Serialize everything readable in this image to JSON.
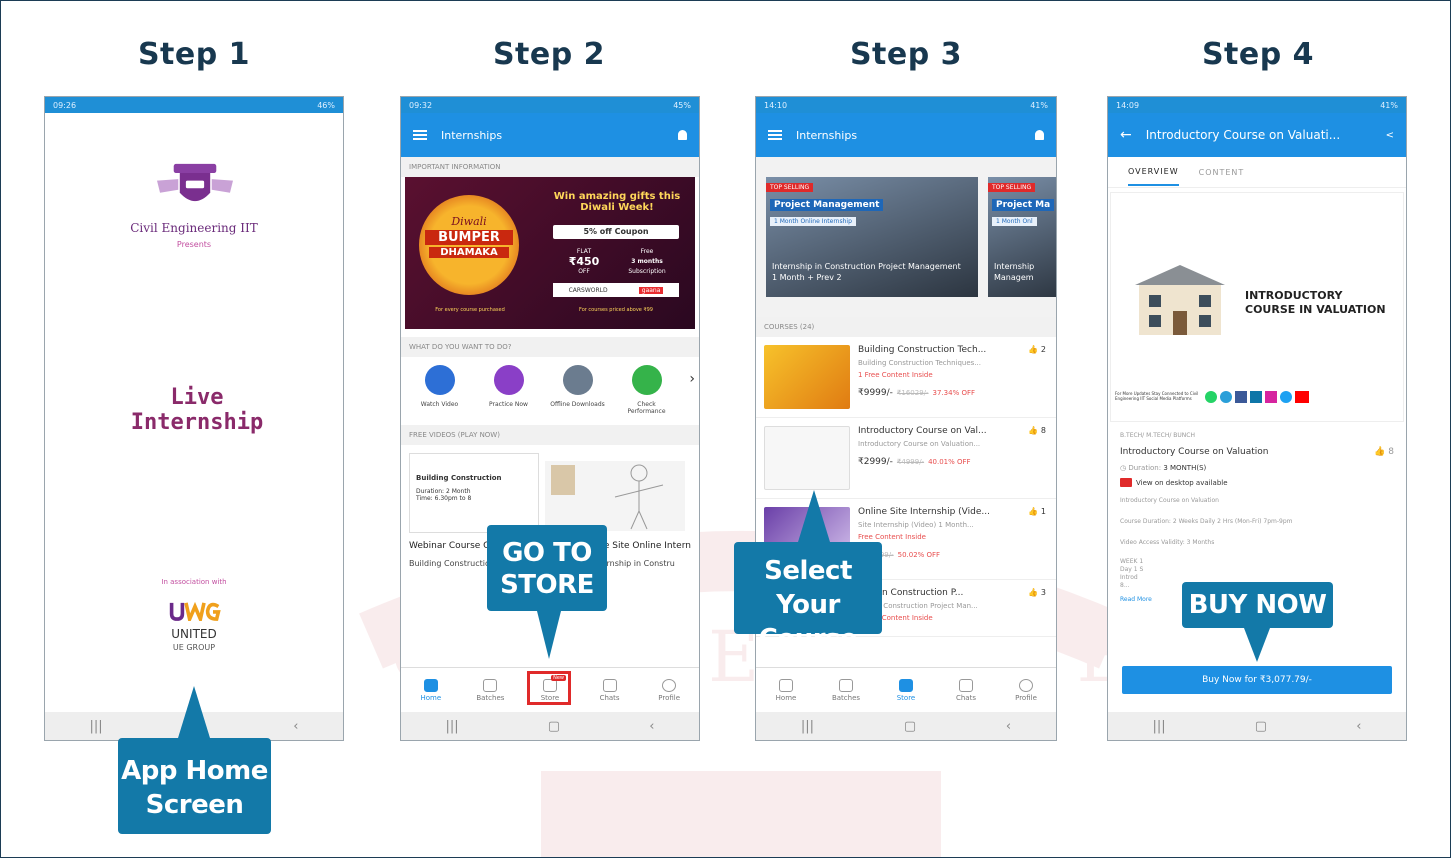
{
  "steps": [
    {
      "title": "Step 1"
    },
    {
      "title": "Step 2"
    },
    {
      "title": "Step 3"
    },
    {
      "title": "Step 4"
    }
  ],
  "callouts": {
    "home": "App Home Screen",
    "store": "GO TO STORE",
    "course": "Select Your Course",
    "buy": "BUY NOW"
  },
  "colors": {
    "brand_blue": "#1e90e3",
    "callout_blue": "#1379a8",
    "title_navy": "#18384f",
    "brand_purple": "#7a2f8f",
    "highlight_red": "#e02a2a"
  },
  "phone1": {
    "status_time": "09:26",
    "status_right": "46%",
    "brand": "Civil Engineering IIT",
    "presents": "Presents",
    "live": "Live",
    "internship": "Internship",
    "association": "In association with",
    "partner_name": "UNITED",
    "partner_sub": "UE GROUP"
  },
  "phone2": {
    "status_time": "09:32",
    "status_right": "45%",
    "appbar_title": "Internships",
    "section_info": "IMPORTANT INFORMATION",
    "banner": {
      "headline": "Win amazing gifts this Diwali Week!",
      "bumper_line1": "Diwali",
      "bumper_line2": "BUMPER",
      "bumper_line3": "DHAMAKA",
      "coupon": "5% off Coupon",
      "flat": "FLAT",
      "flat_amount": "₹450",
      "off": "OFF",
      "free": "Free",
      "free_months": "3 months",
      "subscription": "Subscription",
      "partner1": "CARSWORLD",
      "partner2": "gaana",
      "footer_left": "For every course purchased",
      "footer_right": "For courses priced above ₹99"
    },
    "section_todo": "WHAT DO YOU WANT TO DO?",
    "actions": [
      {
        "label": "Watch Video",
        "color": "#2d6fd6"
      },
      {
        "label": "Practice Now",
        "color": "#8a3fc7"
      },
      {
        "label": "Offline Downloads",
        "color": "#6b7c8f"
      },
      {
        "label": "Check Performance",
        "color": "#35b34a"
      }
    ],
    "section_free": "FREE VIDEOS (PLAY NOW)",
    "video_card_title": "Building Construction",
    "video_card_duration": "Duration: 2 Month",
    "video_card_time": "Time: 6.30pm to 8",
    "video_titles": [
      "Webinar Course Content",
      "Live Site Online Intern"
    ],
    "video_subs": [
      "Building Construction Tec...",
      "Internship in Constru"
    ],
    "bottom_nav": [
      "Home",
      "Batches",
      "Store",
      "Chats",
      "Profile"
    ],
    "store_badge": "New"
  },
  "phone3": {
    "status_time": "14:10",
    "status_right": "41%",
    "appbar_title": "Internships",
    "featured": [
      {
        "tag": "TOP SELLING",
        "title": "Project Management",
        "subtitle": "1 Month Online Internship",
        "caption": "Internship in Construction Project Management 1 Month + Prev 2"
      },
      {
        "tag": "TOP SELLING",
        "title": "Project Ma",
        "subtitle": "1 Month Onl",
        "caption": "Internship Managem"
      }
    ],
    "section_courses": "COURSES (24)",
    "courses": [
      {
        "title": "Building Construction Tech...",
        "sub": "Building Construction Techniques...",
        "free": "1 Free Content Inside",
        "price": "₹9999/-",
        "old": "₹16029/-",
        "off": "37.34% OFF",
        "likes": "2"
      },
      {
        "title": "Introductory Course on Val...",
        "sub": "Introductory Course on Valuation...",
        "free": "",
        "price": "₹2999/-",
        "old": "₹4999/-",
        "off": "40.01% OFF",
        "likes": "8"
      },
      {
        "title": "Online Site Internship (Vide...",
        "sub": "Site Internship (Video) 1 Month...",
        "free": "Free Content Inside",
        "price": "",
        "old": "₹15999/-",
        "off": "50.02% OFF",
        "likes": "1"
      },
      {
        "title": "ship in Construction P...",
        "sub": "ship in Construction Project Man...",
        "free": "2 Free Content Inside",
        "price": "",
        "old": "",
        "off": "",
        "likes": "3"
      }
    ],
    "bottom_nav": [
      "Home",
      "Batches",
      "Store",
      "Chats",
      "Profile"
    ]
  },
  "phone4": {
    "status_time": "14:09",
    "status_right": "41%",
    "appbar_title": "Introductory Course on Valuati...",
    "tabs": [
      "OVERVIEW",
      "CONTENT"
    ],
    "poster_title": "INTRODUCTORY COURSE IN VALUATION",
    "poster_footer": "For More Updates Stay Connected to Civil Engineering IIT Social Media Platforms",
    "breadcrumb": "B.TECH/ M.TECH/ BUNCH",
    "course_title": "Introductory Course on Valuation",
    "likes": "8",
    "duration_label": "Duration:",
    "duration_value": "3 MONTH(S)",
    "desktop_note": "View on desktop available",
    "desc_lines": [
      "Introductory Course on Valuation",
      "Course Duration: 2 Weeks Daily 2 Hrs (Mon-Fri) 7pm-9pm",
      "Video Access Validity: 3 Months"
    ],
    "week_lines": [
      "WEEK 1",
      "Day 1 S",
      "Introd",
      "8..."
    ],
    "read_more": "Read More",
    "buy_button": "Buy Now for ₹3,077.79/-"
  }
}
